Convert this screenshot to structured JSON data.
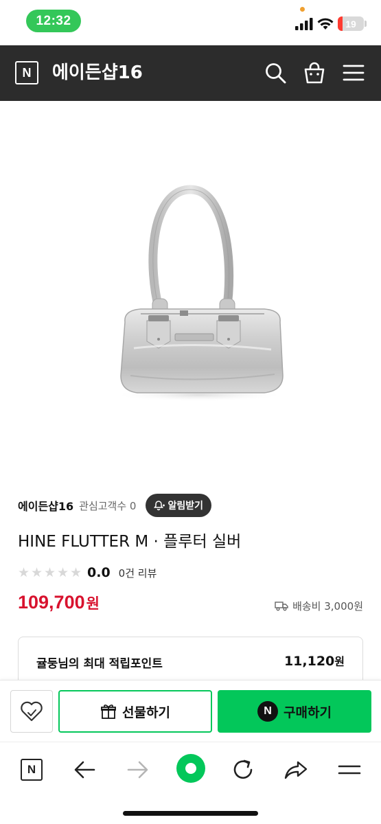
{
  "status_bar": {
    "time": "12:32",
    "battery_level": "19",
    "battery_fraction": 0.19
  },
  "header": {
    "logo": "N",
    "store_title": "에이든샵16",
    "icons": [
      "search-icon",
      "shopping-bag-icon",
      "menu-icon"
    ]
  },
  "store": {
    "name": "에이든샵16",
    "interest_label": "관심고객수 0",
    "alarm_button": "알림받기"
  },
  "product": {
    "title": "HINE FLUTTER M · 플루터 실버",
    "rating": {
      "stars_filled": 0,
      "stars_total": 5,
      "score": "0.0",
      "review_count": "0건 리뷰"
    },
    "price": "109,700",
    "price_unit": "원",
    "shipping": "배송비 3,000원"
  },
  "points": {
    "label": "귤둥님의 최대 적립포인트",
    "value": "11,120",
    "unit": "원"
  },
  "actions": {
    "gift_label": "선물하기",
    "buy_label": "구매하기",
    "buy_logo": "N"
  },
  "browser_nav": {
    "logo": "N",
    "items": [
      "n-home-icon",
      "back-arrow-icon",
      "forward-arrow-icon",
      "green-dot-icon",
      "refresh-icon",
      "share-icon",
      "menu-icon"
    ]
  },
  "colors": {
    "header_bg": "#2c2c2c",
    "price_red": "#d8122e",
    "naver_green": "#03c75a",
    "time_pill_green": "#34c759"
  }
}
